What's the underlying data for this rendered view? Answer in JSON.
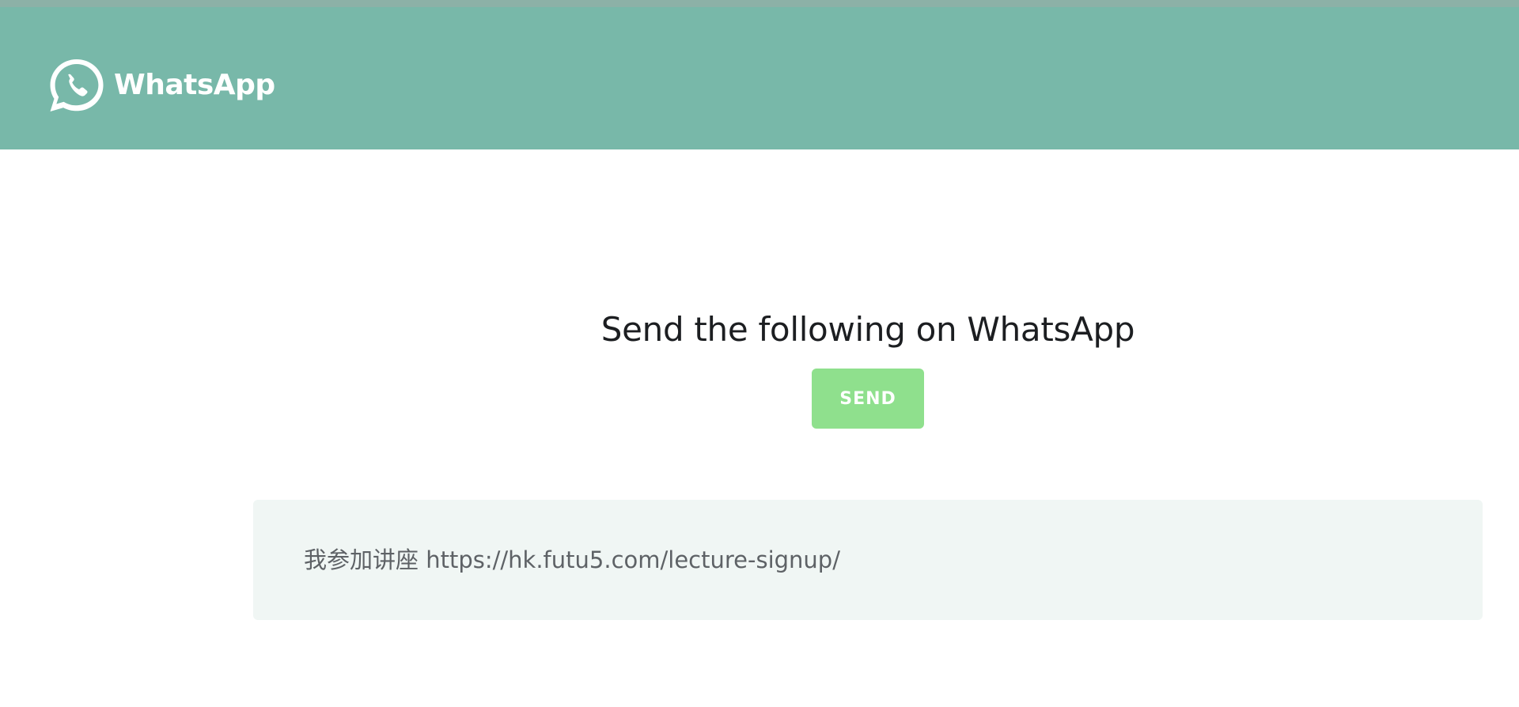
{
  "header": {
    "brand_name": "WhatsApp",
    "logo_icon": "whatsapp-logo-icon",
    "background_color": "#78b8a9"
  },
  "main": {
    "title": "Send the following on WhatsApp",
    "send_button_label": "SEND",
    "send_button_color": "#8fe08d",
    "message": "我参加讲座 https://hk.futu5.com/lecture-signup/",
    "message_box_color": "#f0f6f4"
  }
}
